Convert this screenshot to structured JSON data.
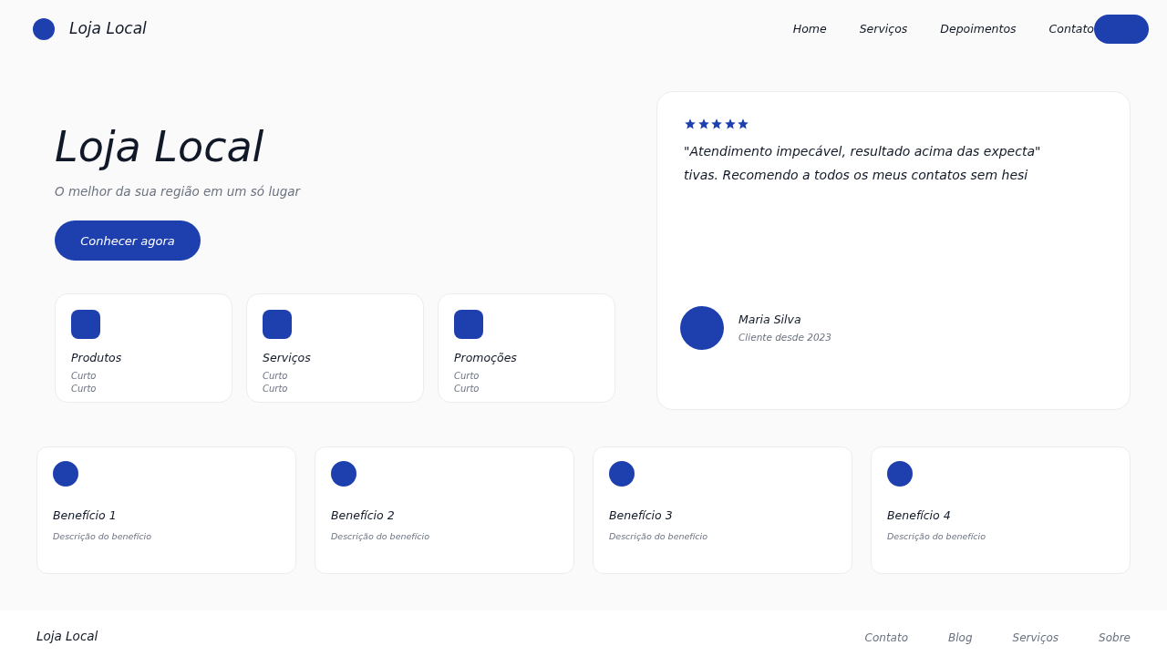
{
  "header": {
    "brand": "Loja Local",
    "nav": [
      {
        "label": "Home"
      },
      {
        "label": "Serviços"
      },
      {
        "label": "Depoimentos"
      },
      {
        "label": "Contato"
      }
    ]
  },
  "hero": {
    "title": "Loja Local",
    "subtitle": "O melhor da sua região em um só lugar",
    "cta": "Conhecer agora",
    "categories": [
      {
        "title": "Produtos",
        "lines": [
          "Curto",
          "Curto"
        ]
      },
      {
        "title": "Serviços",
        "lines": [
          "Curto",
          "Curto"
        ]
      },
      {
        "title": "Promoções",
        "lines": [
          "Curto",
          "Curto"
        ]
      }
    ]
  },
  "testimonial": {
    "stars": 5,
    "quote_lines": [
      "\"Atendimento impecável, resultado acima das expecta\"",
      "tivas. Recomendo a todos os meus contatos sem hesi"
    ],
    "author": "Maria Silva",
    "since": "Cliente desde 2023"
  },
  "benefits": [
    {
      "title": "Benefício 1",
      "description": "Descrição do benefício"
    },
    {
      "title": "Benefício 2",
      "description": "Descrição do benefício"
    },
    {
      "title": "Benefício 3",
      "description": "Descrição do benefício"
    },
    {
      "title": "Benefício 4",
      "description": "Descrição do benefício"
    }
  ],
  "footer": {
    "brand": "Loja Local",
    "links": [
      {
        "label": "Contato"
      },
      {
        "label": "Blog"
      },
      {
        "label": "Serviços"
      },
      {
        "label": "Sobre"
      }
    ]
  }
}
